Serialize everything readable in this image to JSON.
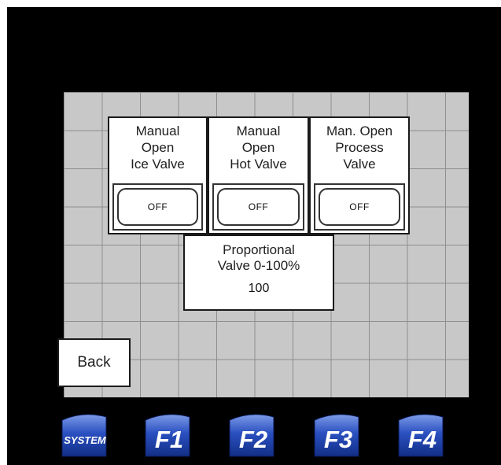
{
  "panels": [
    {
      "label": "Manual\nOpen\nIce Valve",
      "button": "OFF"
    },
    {
      "label": "Manual\nOpen\nHot Valve",
      "button": "OFF"
    },
    {
      "label": "Man. Open\nProcess\nValve",
      "button": "OFF"
    }
  ],
  "proportional": {
    "label": "Proportional\nValve 0-100%",
    "value": "100"
  },
  "back_label": "Back",
  "function_keys": [
    "SYSTEM",
    "F1",
    "F2",
    "F3",
    "F4"
  ],
  "colors": {
    "screen": "#000000",
    "grid": "#c8c8c8",
    "key_blue": "#1a3fa8",
    "key_light": "#6f8fe0"
  }
}
